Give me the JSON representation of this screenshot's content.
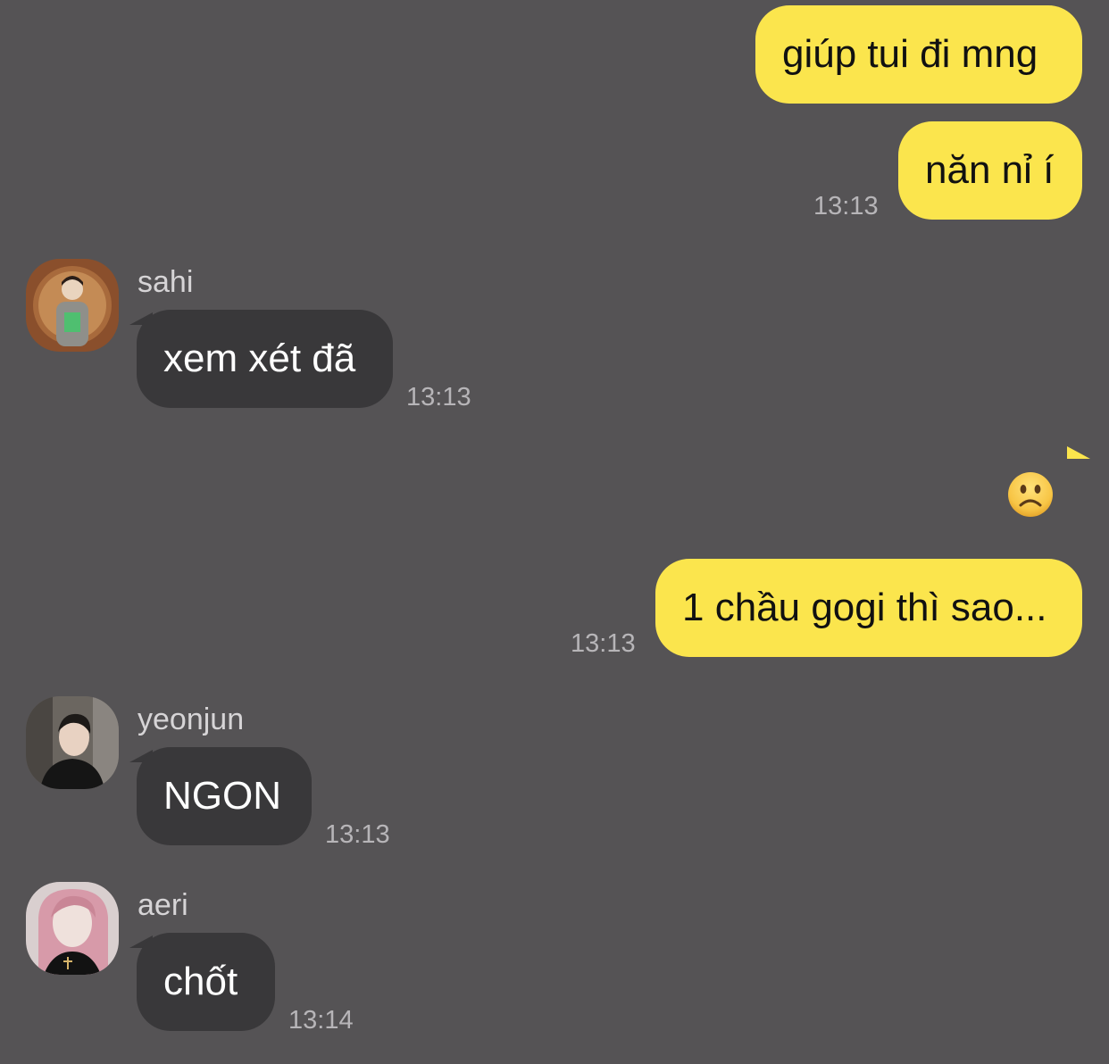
{
  "chat": {
    "messages": [
      {
        "sender": "me",
        "text": "giúp tui đi mng"
      },
      {
        "sender": "me",
        "text": "năn nỉ í",
        "time": "13:13"
      },
      {
        "sender": "sahi",
        "text": "xem xét đã",
        "time": "13:13"
      },
      {
        "sender": "me",
        "emoji": "frowning-face",
        "text": ""
      },
      {
        "sender": "me",
        "text": "1 chầu gogi thì sao...",
        "time": "13:13"
      },
      {
        "sender": "yeonjun",
        "text": "NGON",
        "time": "13:13"
      },
      {
        "sender": "aeri",
        "text": "chốt",
        "time": "13:14"
      }
    ],
    "users": {
      "sahi": {
        "name": "sahi"
      },
      "yeonjun": {
        "name": "yeonjun"
      },
      "aeri": {
        "name": "aeri"
      }
    }
  },
  "colors": {
    "background": "#555355",
    "my_bubble": "#fbe54d",
    "their_bubble": "#39383a",
    "timestamp": "#b7b5b8"
  },
  "icons": {
    "emoji": "frowning-face-emoji"
  }
}
